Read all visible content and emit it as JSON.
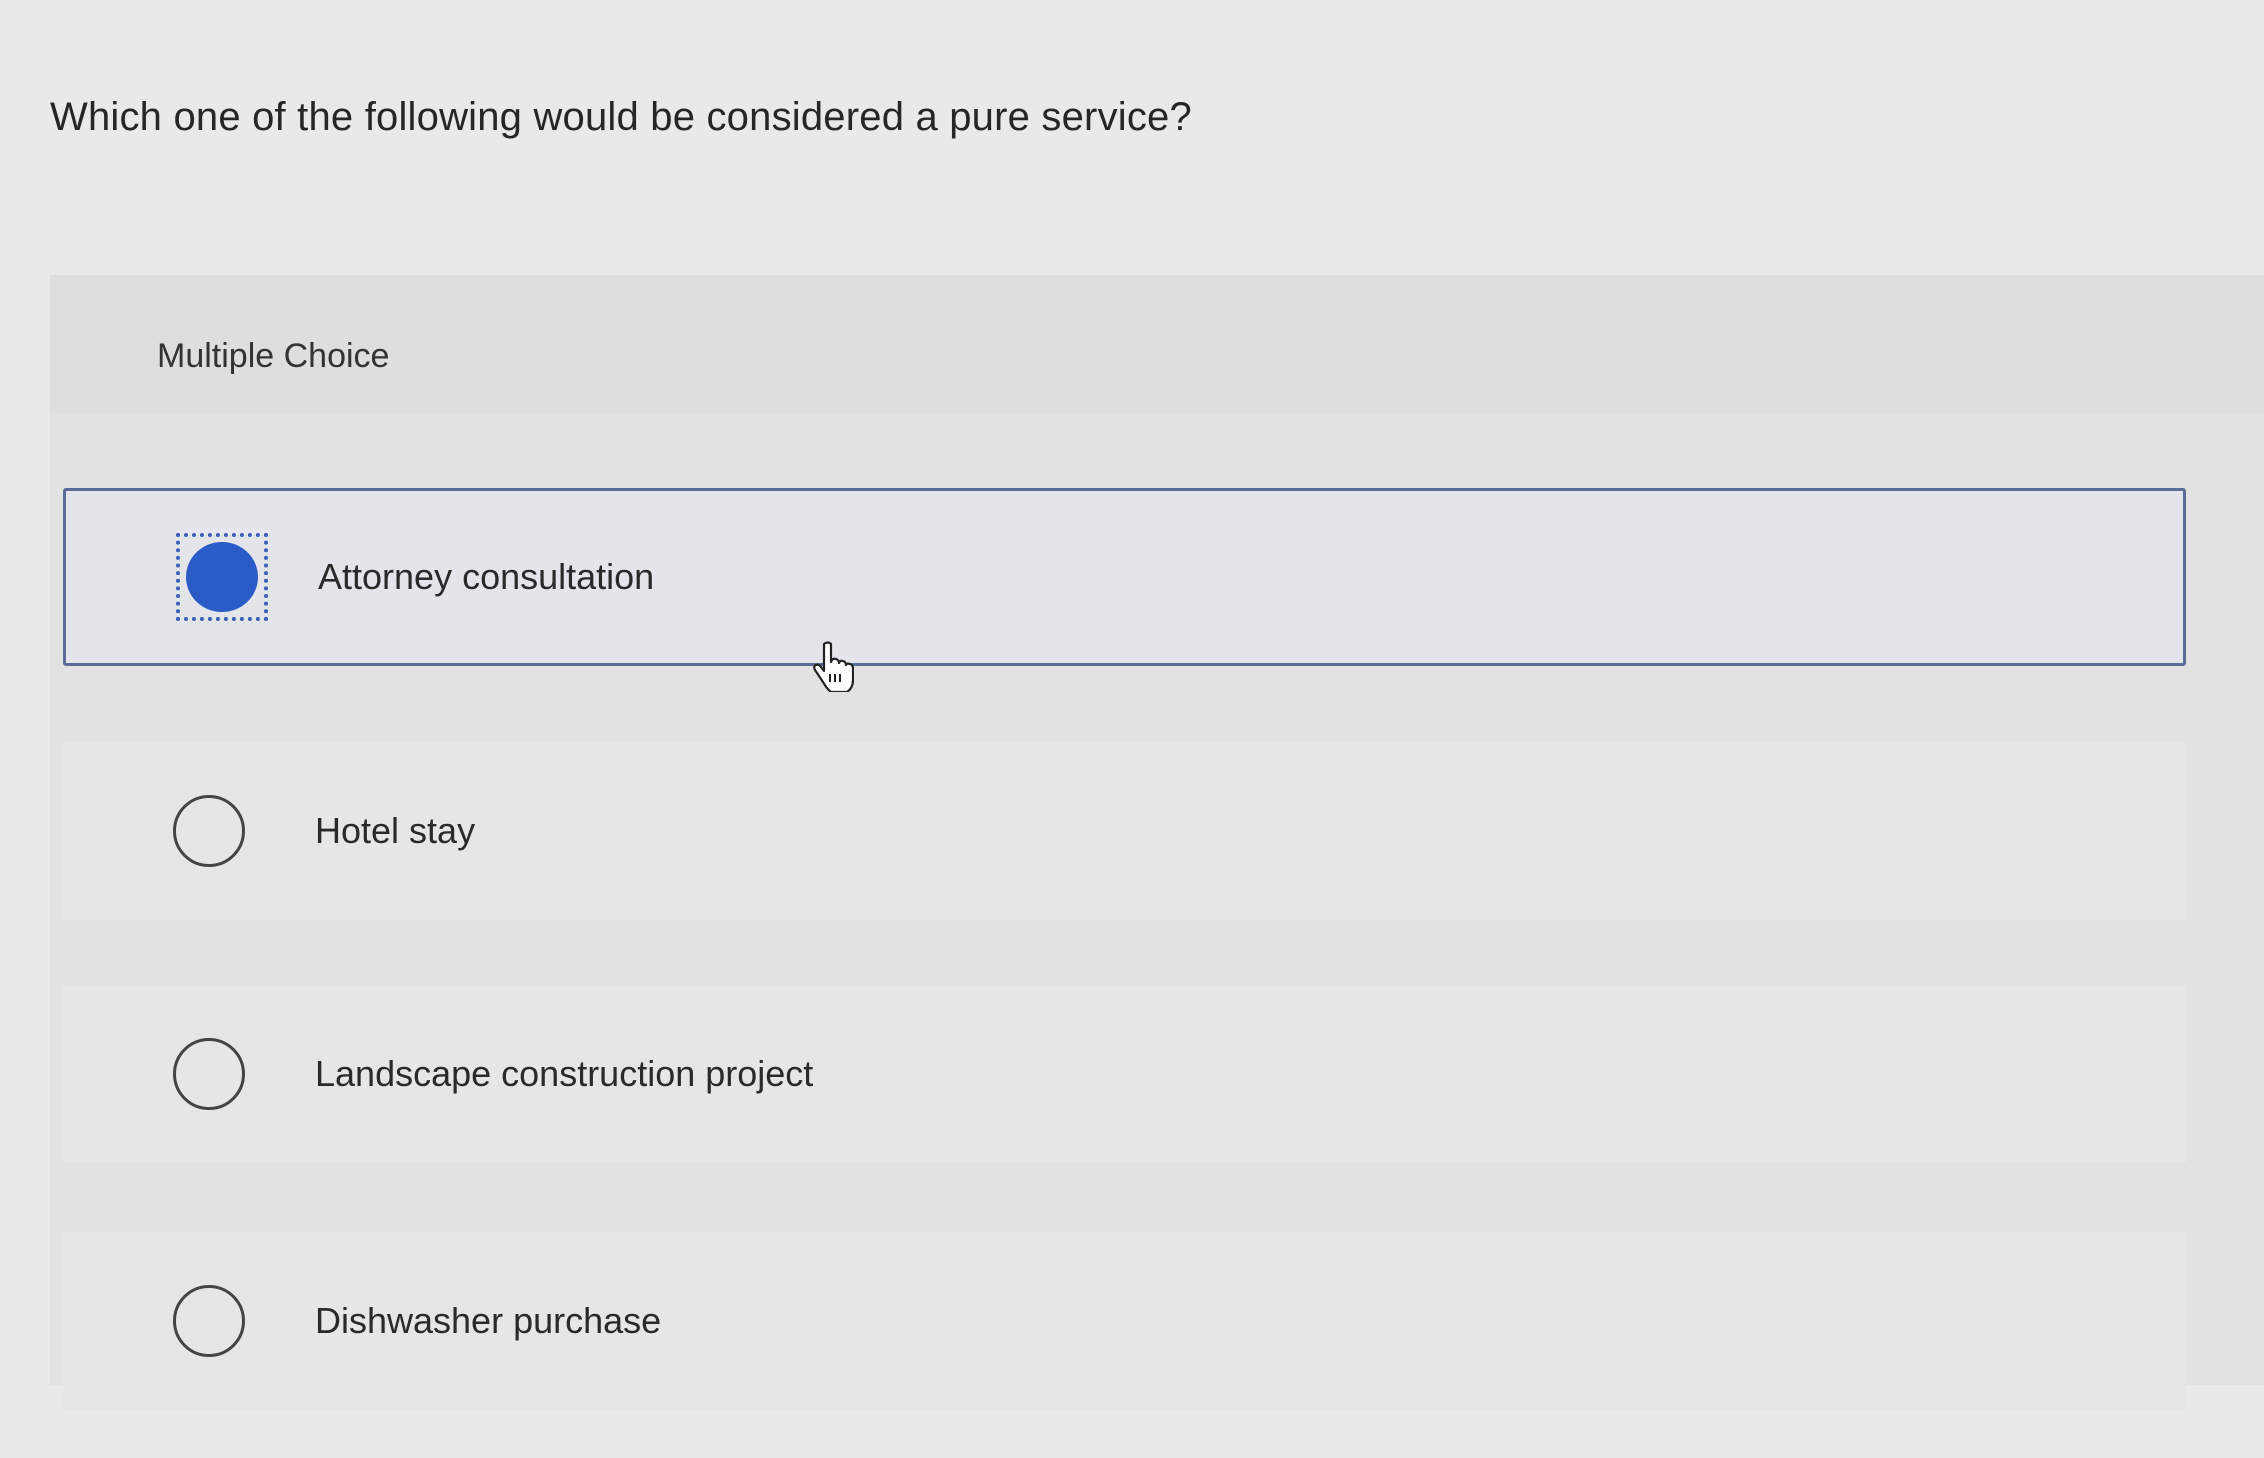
{
  "question": {
    "text": "Which one of the following would be considered a pure service?"
  },
  "multiple_choice": {
    "label": "Multiple Choice",
    "options": [
      {
        "label": "Attorney consultation",
        "selected": true
      },
      {
        "label": "Hotel stay",
        "selected": false
      },
      {
        "label": "Landscape construction project",
        "selected": false
      },
      {
        "label": "Dishwasher purchase",
        "selected": false
      }
    ]
  },
  "colors": {
    "selected_radio": "#2b5bc6",
    "selected_border": "#5a6c9a",
    "background": "#e9e9e7"
  },
  "icons": {
    "cursor": "hand-pointer-icon"
  }
}
